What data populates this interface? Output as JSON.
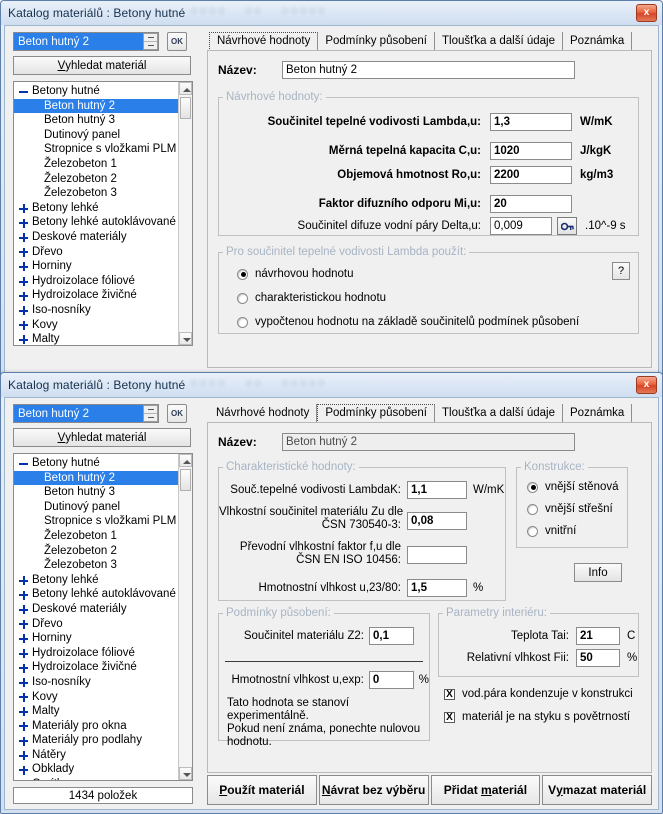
{
  "window1": {
    "title": "Katalog materiálů : Betony hutné",
    "close_label": "x",
    "combo_value": "Beton hutný 2",
    "ok_button": "OK",
    "search_button_pre": "V",
    "search_button_post": "yhledat materiál",
    "tabs": [
      {
        "label": "Návrhové hodnoty",
        "active": true
      },
      {
        "label": "Podmínky působení",
        "active": false
      },
      {
        "label": "Tloušťka a další údaje",
        "active": false
      },
      {
        "label": "Poznámka",
        "active": false
      }
    ],
    "name_label": "Název:",
    "name_value": "Beton hutný 2",
    "group_design": {
      "legend": "Návrhové hodnoty:",
      "rows": [
        {
          "label": "Součinitel tepelné vodivosti  Lambda,u:",
          "value": "1,3",
          "unit": "W/mK"
        },
        {
          "label": "Měrná tepelná kapacita  C,u:",
          "value": "1020",
          "unit": "J/kgK"
        },
        {
          "label": "Objemová hmotnost  Ro,u:",
          "value": "2200",
          "unit": "kg/m3"
        },
        {
          "label": "Faktor difuzního odporu  Mi,u:",
          "value": "20",
          "unit": ""
        },
        {
          "label": "Součinitel difuze vodní páry  Delta,u:",
          "value": "0,009",
          "unit": ".10^-9 s"
        }
      ],
      "key_icon": "key-icon"
    },
    "group_lambda": {
      "legend": "Pro součinitel tepelné vodivosti Lambda použít:",
      "help": "?",
      "options": [
        {
          "label": "návrhovou hodnotu",
          "selected": true
        },
        {
          "label": "charakteristickou hodnotu",
          "selected": false
        },
        {
          "label": "vypočtenou hodnotu na základě součinitelů podmínek působení",
          "selected": false
        }
      ]
    }
  },
  "window2": {
    "title": "Katalog materiálů : Betony hutné",
    "close_label": "x",
    "combo_value": "Beton hutný 2",
    "ok_button": "OK",
    "search_button_pre": "V",
    "search_button_post": "yhledat materiál",
    "tabs": [
      {
        "label": "Návrhové hodnoty",
        "active": false
      },
      {
        "label": "Podmínky působení",
        "active": true
      },
      {
        "label": "Tloušťka a další údaje",
        "active": false
      },
      {
        "label": "Poznámka",
        "active": false
      }
    ],
    "name_label": "Název:",
    "name_value": "Beton hutný 2",
    "group_char": {
      "legend": "Charakteristické hodnoty:",
      "rows": [
        {
          "label": "Souč.tepelné vodivosti LambdaK:",
          "label2": "",
          "value": "1,1",
          "unit": "W/mK"
        },
        {
          "label": "Vlhkostní součinitel materiálu Zu dle",
          "label2": "ČSN 730540-3:",
          "value": "0,08",
          "unit": ""
        },
        {
          "label": "Převodní vlhkostní faktor f,u dle",
          "label2": "ČSN EN ISO 10456:",
          "value": "",
          "unit": ""
        },
        {
          "label": "Hmotnostní vlhkost u,23/80:",
          "label2": "",
          "value": "1,5",
          "unit": "%"
        }
      ]
    },
    "group_constr": {
      "legend": "Konstrukce:",
      "options": [
        {
          "label": "vnější stěnová",
          "selected": true
        },
        {
          "label": "vnější střešní",
          "selected": false
        },
        {
          "label": "vnitřní",
          "selected": false
        }
      ]
    },
    "info_button": "Info",
    "group_cond": {
      "legend": "Podmínky působení:",
      "row1_label": "Součinitel materiálu Z2:",
      "row1_value": "0,1",
      "row2_label": "Hmotnostní vlhkost u,exp:",
      "row2_value": "0",
      "row2_unit": "%",
      "note_line1": "Tato hodnota se stanoví experimentálně.",
      "note_line2": "Pokud není známa, ponechte nulovou",
      "note_line3": "hodnotu."
    },
    "group_interior": {
      "legend": "Parametry interiéru:",
      "rows": [
        {
          "label": "Teplota Tai:",
          "value": "21",
          "unit": "C"
        },
        {
          "label": "Relativní vlhkost Fii:",
          "value": "50",
          "unit": "%"
        }
      ]
    },
    "checkboxes": [
      {
        "label": "vod.pára kondenzuje v konstrukci",
        "checked": true,
        "mark": "X"
      },
      {
        "label": "materiál je na styku s povětrností",
        "checked": true,
        "mark": "X"
      }
    ],
    "buttons": [
      {
        "pre": "P",
        "post": "oužít materiál"
      },
      {
        "pre": "N",
        "post": "ávrat bez výběru"
      },
      {
        "pre": "",
        "post": "Přidat materiál",
        "mid_underline": "m"
      },
      {
        "pre": "",
        "post": "Vymazat materiál"
      }
    ],
    "button_labels": {
      "use": "Použít materiál",
      "back": "Návrat bez výběru",
      "add": "Přidat materiál",
      "delete": "Vymazat materiál"
    }
  },
  "tree": {
    "count_label": "1434 položek",
    "nodes": [
      {
        "label": "Betony hutné",
        "type": "group",
        "expanded": true
      },
      {
        "label": "Beton hutný 2",
        "type": "child",
        "selected": true
      },
      {
        "label": "Beton hutný 3",
        "type": "child",
        "selected": false
      },
      {
        "label": "Dutinový panel",
        "type": "child",
        "selected": false
      },
      {
        "label": "Stropnice s vložkami PLM",
        "type": "child",
        "selected": false
      },
      {
        "label": "Železobeton 1",
        "type": "child",
        "selected": false
      },
      {
        "label": "Železobeton 2",
        "type": "child",
        "selected": false
      },
      {
        "label": "Železobeton 3",
        "type": "child",
        "selected": false
      },
      {
        "label": "Betony lehké",
        "type": "group",
        "expanded": false
      },
      {
        "label": "Betony lehké autoklávované",
        "type": "group",
        "expanded": false
      },
      {
        "label": "Deskové materiály",
        "type": "group",
        "expanded": false
      },
      {
        "label": "Dřevo",
        "type": "group",
        "expanded": false
      },
      {
        "label": "Horniny",
        "type": "group",
        "expanded": false
      },
      {
        "label": "Hydroizolace fóliové",
        "type": "group",
        "expanded": false
      },
      {
        "label": "Hydroizolace živičné",
        "type": "group",
        "expanded": false
      },
      {
        "label": "Iso-nosníky",
        "type": "group",
        "expanded": false
      },
      {
        "label": "Kovy",
        "type": "group",
        "expanded": false
      },
      {
        "label": "Malty",
        "type": "group",
        "expanded": false
      },
      {
        "label": "Materiály pro okna",
        "type": "group",
        "expanded": false
      },
      {
        "label": "Materiály pro podlahy",
        "type": "group",
        "expanded": false
      },
      {
        "label": "Nátěry",
        "type": "group",
        "expanded": false
      },
      {
        "label": "Obklady",
        "type": "group",
        "expanded": false
      },
      {
        "label": "Omítky",
        "type": "group",
        "expanded": false
      }
    ]
  },
  "colors": {
    "accent": "#2a7fe8",
    "close": "#e8653c",
    "tree_plus": "#0432a8",
    "legend": "#a8b4c4"
  }
}
